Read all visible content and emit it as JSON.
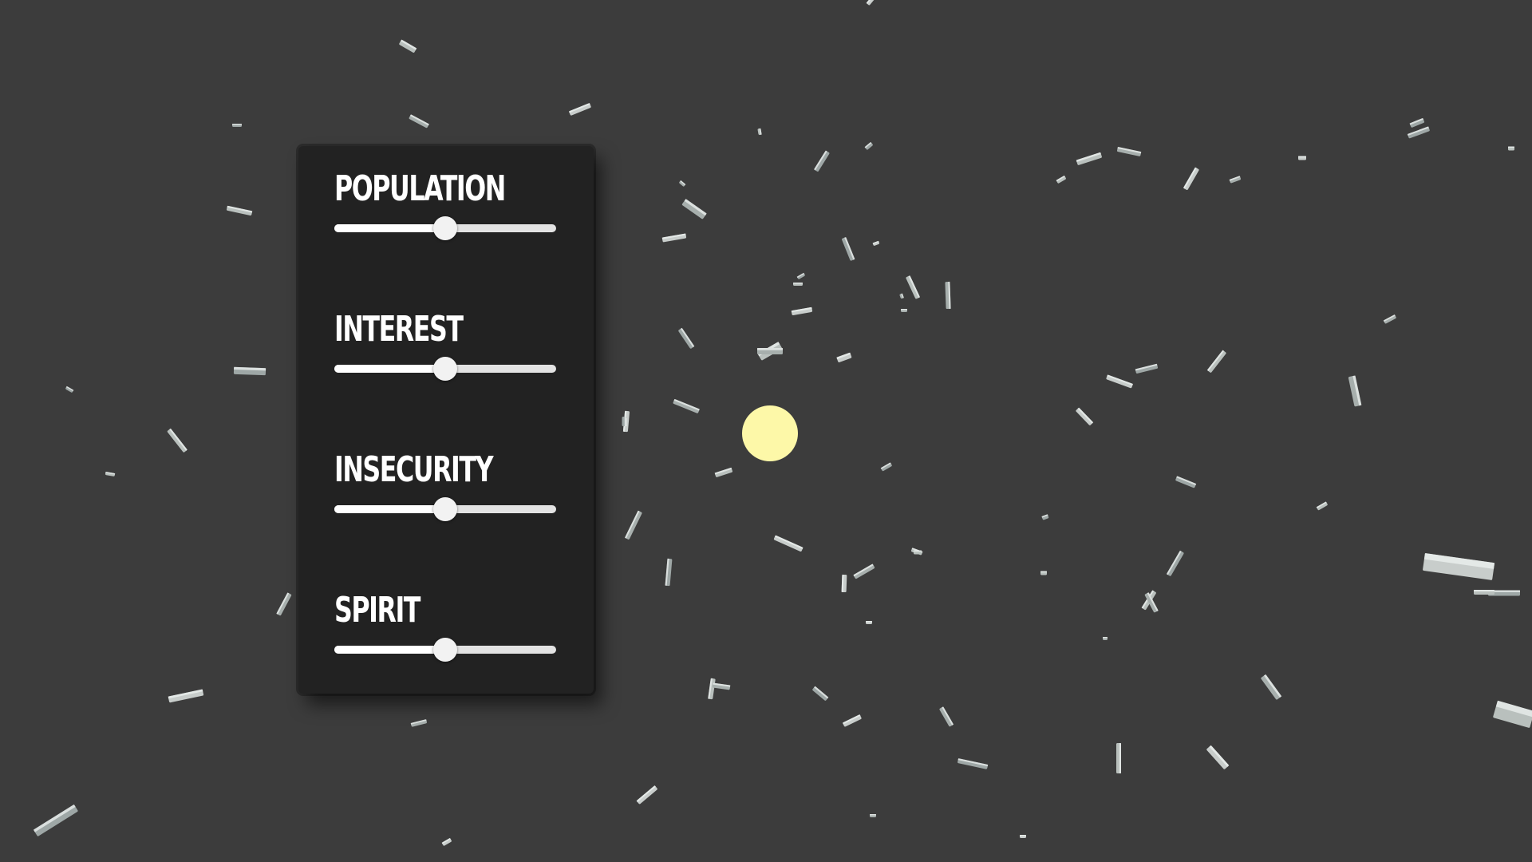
{
  "colors": {
    "background": "#3c3c3c",
    "panel": "#222222",
    "label": "#ffffff",
    "track": "#e3e3e3",
    "thumb": "#f2f2f2",
    "sun": "#fdf8a8",
    "shard": "#b4bbb8"
  },
  "controls": [
    {
      "label": "POPULATION",
      "value": 0.5
    },
    {
      "label": "INTEREST",
      "value": 0.5
    },
    {
      "label": "INSECURITY",
      "value": 0.5
    },
    {
      "label": "SPIRIT",
      "value": 0.5
    }
  ]
}
